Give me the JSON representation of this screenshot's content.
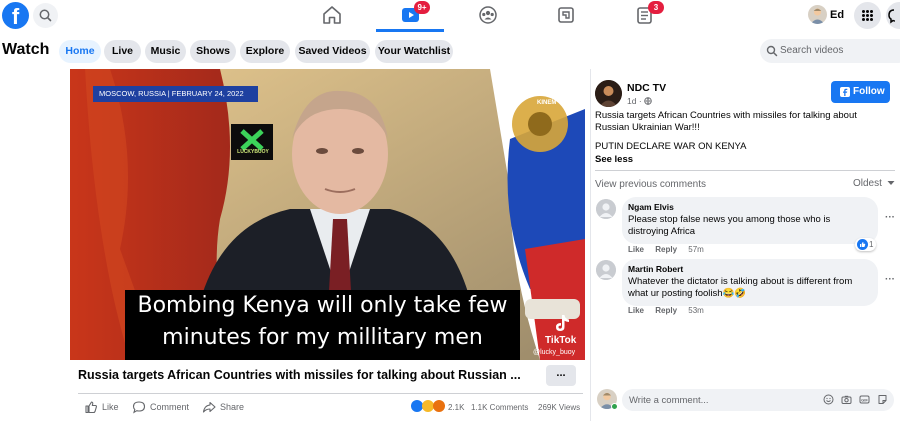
{
  "topbar": {
    "logo": "f",
    "icons": [
      "facebook-logo",
      "search-icon",
      "home-icon",
      "watch-icon",
      "groups-icon",
      "gaming-icon",
      "news-feed-icon",
      "menu-grid-icon",
      "messenger-icon"
    ],
    "watch_badge": "9+",
    "feeds_badge": "3",
    "profile_name": "Ed",
    "accent": "#1877f2",
    "badge_color": "#e41e3f"
  },
  "watch_nav": {
    "title": "Watch",
    "tabs": [
      {
        "label": "Home",
        "active": true
      },
      {
        "label": "Live",
        "active": false
      },
      {
        "label": "Music",
        "active": false
      },
      {
        "label": "Shows",
        "active": false
      },
      {
        "label": "Explore",
        "active": false
      },
      {
        "label": "Saved Videos",
        "active": false
      },
      {
        "label": "Your Watchlist",
        "active": false
      }
    ],
    "search_placeholder": "Search videos"
  },
  "video": {
    "dateline": "MOSCOW, RUSSIA | FEBRUARY 24, 2022",
    "sticker_text": "LUCKYBUOY",
    "caption_line1": "Bombing Kenya will only take few",
    "caption_line2": "minutes for my millitary men",
    "kinematic": "KINEM",
    "tiktok_label": "TikTok",
    "tiktok_handle": "@lucky_buoy",
    "title": "Russia targets African Countries with missiles for talking about Russian ...",
    "more": "..."
  },
  "post_actions": {
    "like": "Like",
    "comment": "Comment",
    "share": "Share",
    "reactions_count": "2.1K",
    "comments_count": "1.1K Comments",
    "views_count": "269K Views"
  },
  "side_panel": {
    "page_name": "NDC TV",
    "post_age": "1d",
    "follow_label": "Follow",
    "post_text_line1": "Russia targets African Countries with missiles for talking about",
    "post_text_line2": "Russian Ukrainian War!!!",
    "post_text_line3": "PUTIN DECLARE WAR ON KENYA",
    "see_less": "See less",
    "view_previous": "View previous comments",
    "sort_label": "Oldest"
  },
  "comments": [
    {
      "author": "Ngam Elvis",
      "text_line1": "Please stop false news you among those who is",
      "text_line2": "distroying Africa",
      "like": "Like",
      "reply": "Reply",
      "time": "57m",
      "reaction_count": "1"
    },
    {
      "author": "Martin Robert",
      "text_line1": "Whatever the dictator is talking about is different from",
      "text_line2": "what ur posting foolish😂🤣",
      "like": "Like",
      "reply": "Reply",
      "time": "53m"
    }
  ],
  "write_comment": {
    "placeholder": "Write a comment..."
  }
}
